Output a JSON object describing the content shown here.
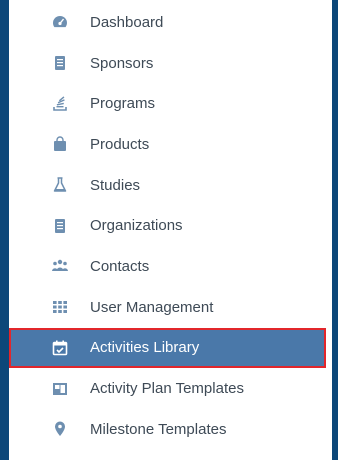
{
  "sidebar": {
    "active_color": "#4a78a9",
    "highlight_border_color": "#e2262b",
    "items": [
      {
        "label": "Dashboard",
        "icon": "dashboard-icon"
      },
      {
        "label": "Sponsors",
        "icon": "document-icon"
      },
      {
        "label": "Programs",
        "icon": "stack-icon"
      },
      {
        "label": "Products",
        "icon": "shopping-bag-icon"
      },
      {
        "label": "Studies",
        "icon": "flask-icon"
      },
      {
        "label": "Organizations",
        "icon": "building-icon"
      },
      {
        "label": "Contacts",
        "icon": "users-icon"
      },
      {
        "label": "User Management",
        "icon": "grid-icon"
      },
      {
        "label": "Activities Library",
        "icon": "calendar-check-icon",
        "active": true
      },
      {
        "label": "Activity Plan Templates",
        "icon": "layout-icon"
      },
      {
        "label": "Milestone Templates",
        "icon": "map-pin-icon"
      }
    ]
  }
}
